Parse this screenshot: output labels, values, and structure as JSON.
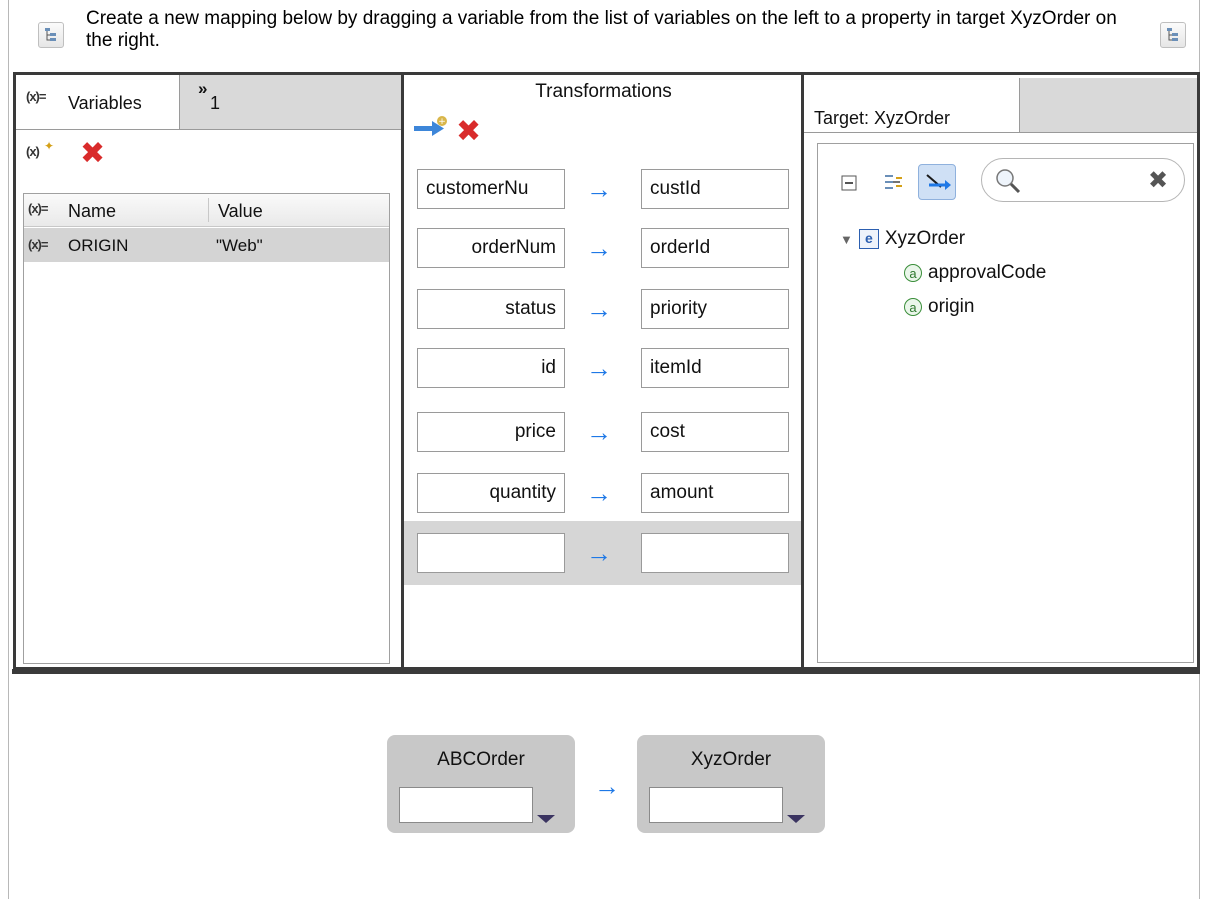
{
  "message": "Create a new mapping below by dragging a variable from the list of variables on the left to a property in target XyzOrder on the right.",
  "left_pane": {
    "tabs": [
      {
        "icon": "(x)=",
        "label": "Variables"
      },
      {
        "icon": "»",
        "label": "1"
      }
    ],
    "table": {
      "headers": {
        "icon": "(x)=",
        "name": "Name",
        "value": "Value"
      },
      "rows": [
        {
          "icon": "(x)=",
          "name": "ORIGIN",
          "value": "\"Web\""
        }
      ]
    }
  },
  "middle_pane": {
    "title": "Transformations",
    "mappings": [
      {
        "source": "customerNu",
        "target": "custId"
      },
      {
        "source": "orderNum",
        "target": "orderId"
      },
      {
        "source": "status",
        "target": "priority"
      },
      {
        "source": "id",
        "target": "itemId"
      },
      {
        "source": "price",
        "target": "cost"
      },
      {
        "source": "quantity",
        "target": "amount"
      },
      {
        "source": "",
        "target": ""
      }
    ]
  },
  "right_pane": {
    "tab_label": "Target: XyzOrder",
    "tree": {
      "root": {
        "icon": "e",
        "label": "XyzOrder"
      },
      "children": [
        {
          "icon": "a",
          "label": "approvalCode"
        },
        {
          "icon": "a",
          "label": "origin"
        }
      ]
    }
  },
  "bottom": {
    "source_label": "ABCOrder",
    "target_label": "XyzOrder"
  },
  "colors": {
    "arrow": "#1e78e6",
    "delete": "#d92b2b",
    "pane_border": "#3a3a3a"
  }
}
